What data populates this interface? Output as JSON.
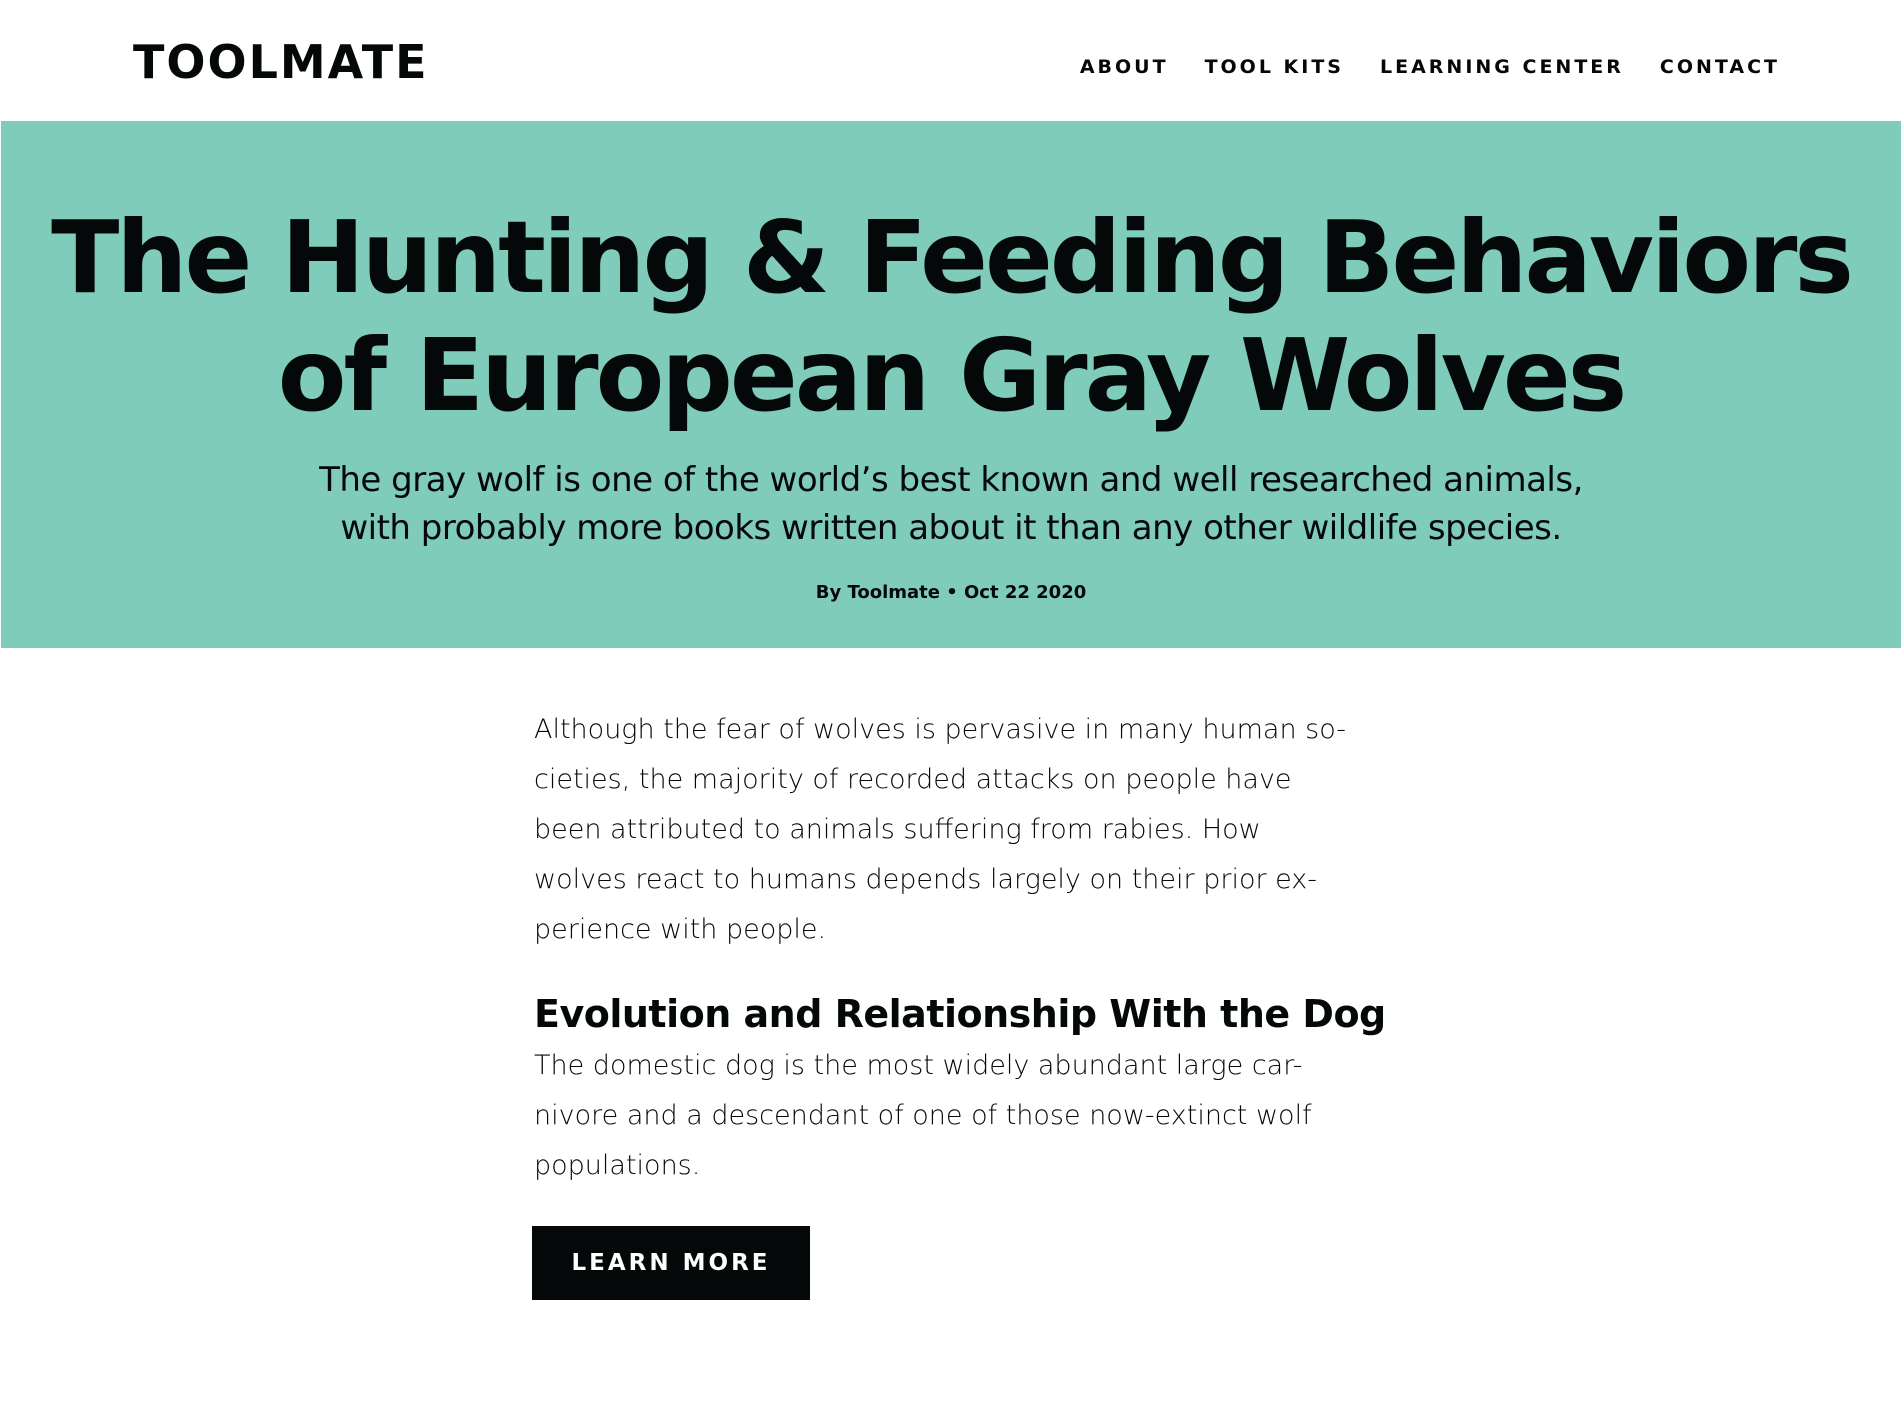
{
  "header": {
    "logo": "TOOLMATE",
    "nav": [
      {
        "label": "ABOUT"
      },
      {
        "label": "TOOL KITS"
      },
      {
        "label": "LEARNING CENTER"
      },
      {
        "label": "CONTACT"
      }
    ]
  },
  "hero": {
    "background_color": "#80ccba",
    "title": "The Hunting & Feeding Behaviors of European Gray Wolves",
    "subtitle_lines": [
      "The gray wolf is one of the world’s best known and well researched animals,",
      "with probably more books written about it than any other wildlife species."
    ],
    "byline": "By Toolmate • Oct 22 2020"
  },
  "article": {
    "intro_lines": [
      "Although the fear of wolves is pervasive in many human so-",
      "cieties, the majority of recorded attacks on people have",
      "been attributed to animals suffering from rabies. How",
      "wolves react to humans depends largely on their prior ex-",
      "perience with people."
    ],
    "section_heading": "Evolution and Relationship With the Dog",
    "section_lines": [
      "The domestic dog is the most widely abundant large car-",
      "nivore and a descendant of one of those now-extinct wolf",
      "populations."
    ],
    "button_label": "LEARN MORE"
  }
}
